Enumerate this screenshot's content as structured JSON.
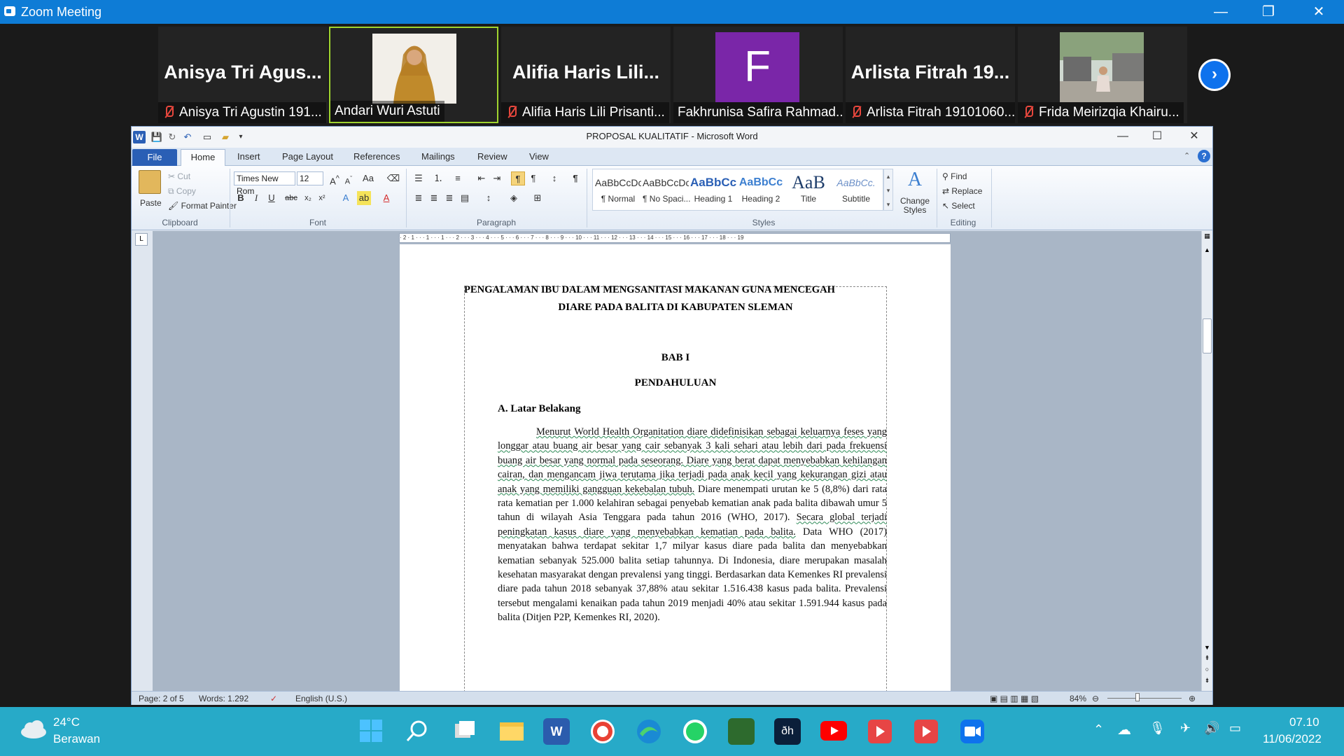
{
  "zoom": {
    "title": "Zoom Meeting",
    "participants": [
      {
        "big": "Anisya  Tri  Agus...",
        "caption": "Anisya Tri Agustin 191...",
        "muted": true
      },
      {
        "big": "",
        "caption": "Andari Wuri Astuti",
        "muted": false,
        "active": true
      },
      {
        "big": "Alifia  Haris  Lili...",
        "caption": "Alifia Haris Lili Prisanti...",
        "muted": true
      },
      {
        "big": "F",
        "caption": "Fakhrunisa Safira Rahmad...",
        "muted": false
      },
      {
        "big": "Arlista  Fitrah  19...",
        "caption": "Arlista Fitrah 19101060...",
        "muted": true
      },
      {
        "big": "",
        "caption": "Frida Meirizqia Khairu...",
        "muted": true
      }
    ]
  },
  "word": {
    "title": "PROPOSAL KUALITATIF  -  Microsoft Word",
    "tabs": [
      "File",
      "Home",
      "Insert",
      "Page Layout",
      "References",
      "Mailings",
      "Review",
      "View"
    ],
    "clipboard": {
      "paste": "Paste",
      "cut": "Cut",
      "copy": "Copy",
      "format_painter": "Format Painter",
      "label": "Clipboard"
    },
    "font": {
      "name": "Times New Rom",
      "size": "12",
      "label": "Font"
    },
    "paragraph": {
      "label": "Paragraph"
    },
    "styles": {
      "label": "Styles",
      "items": [
        {
          "sample": "AaBbCcDc",
          "name": "¶ Normal"
        },
        {
          "sample": "AaBbCcDc",
          "name": "¶ No Spaci..."
        },
        {
          "sample": "AaBbCc",
          "name": "Heading 1"
        },
        {
          "sample": "AaBbCc",
          "name": "Heading 2"
        },
        {
          "sample": "AaB",
          "name": "Title"
        },
        {
          "sample": "AaBbCc.",
          "name": "Subtitle"
        }
      ],
      "change": "Change Styles"
    },
    "editing": {
      "find": "Find",
      "replace": "Replace",
      "select": "Select",
      "label": "Editing"
    },
    "ruler": "· 2 · 1 · · · 1 · · · 1 · · · 2 · · · 3 · · · 4 · · · 5 · · · 6 · · · 7 · · · 8 · · · 9 · · · 10 · · · 11 · · · 12 · · · 13 · · · 14 · · · 15 · · · 16 · · · 17 · · · 18 · · · 19",
    "document": {
      "title_line1": "PENGALAMAN IBU DALAM MENGSANITASI  MAKANAN GUNA MENCEGAH",
      "title_line2": "DIARE PADA BALITA DI KABUPATEN SLEMAN",
      "bab": "BAB I",
      "pendahuluan": "PENDAHULUAN",
      "section": "A.  Latar Belakang",
      "p_wavy1": "Menurut World Health Organitation diare didefinisikan sebagai keluarnya feses yang longgar atau buang air besar yang cair sebanyak 3 kali sehari atau lebih dari pada frekuensi buang air besar yang normal pada seseorang. Diare yang berat dapat menyebabkan kehilangan cairan, dan mengancam jiwa terutama jika terjadi pada anak kecil yang kekurangan gizi atau anak yang memiliki gangguan kekebalan tubuh.",
      "p_plain1": " Diare menempati urutan ke 5 (8,8%) dari rata rata kematian per 1.000 kelahiran sebagai penyebab kematian anak pada balita dibawah umur 5 tahun di wilayah Asia Tenggara pada tahun 2016 (WHO, 2017). ",
      "p_wavy2": "Secara global terjadi peningkatan kasus diare yang menyebabkan kematian pada balita.",
      "p_plain2": " Data WHO (2017) menyatakan bahwa terdapat sekitar 1,7 milyar kasus diare pada balita dan menyebabkan kematian sebanyak 525.000 balita setiap tahunnya. Di Indonesia, diare merupakan masalah kesehatan masyarakat dengan prevalensi yang tinggi. Berdasarkan data Kemenkes RI prevalensi diare pada tahun 2018 sebanyak 37,88% atau sekitar 1.516.438 kasus pada balita. Prevalensi tersebut mengalami kenaikan pada tahun 2019 menjadi 40% atau sekitar 1.591.944 kasus pada balita (Ditjen P2P, Kemenkes RI, 2020)."
    },
    "status": {
      "page": "Page: 2 of 5",
      "words": "Words: 1.292",
      "lang": "English (U.S.)",
      "zoom": "84%"
    }
  },
  "taskbar": {
    "temp": "24°C",
    "weather": "Berawan",
    "time": "07.10",
    "date": "11/06/2022"
  }
}
